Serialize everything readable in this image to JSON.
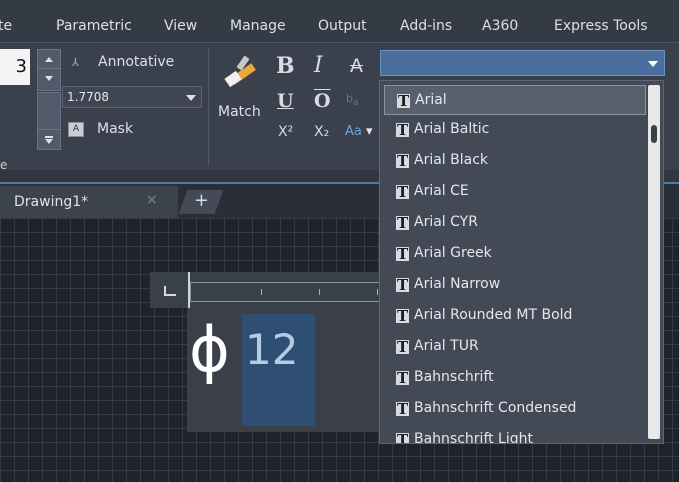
{
  "menubar": {
    "items": [
      "te",
      "Parametric",
      "View",
      "Manage",
      "Output",
      "Add-ins",
      "A360",
      "Express Tools"
    ]
  },
  "ribbon": {
    "text_height_value": "3",
    "annotative_label": "Annotative",
    "height_combo_value": "1.7708",
    "mask_label": "Mask",
    "panel_title_fragment": "e",
    "match_label": "Match",
    "bold_label": "B",
    "italic_label": "I",
    "strike_label": "A",
    "underline_label": "U",
    "overline_label": "O",
    "superscript_label": "X²",
    "subscript_label": "X₂",
    "case_label": "Aa"
  },
  "tabs": {
    "drawing_tab_label": "Drawing1*",
    "close_glyph": "×",
    "add_glyph": "+"
  },
  "editor": {
    "symbol": "ϕ",
    "selected_text": "12"
  },
  "font_dropdown": {
    "current_value": "",
    "items": [
      "Arial",
      "Arial Baltic",
      "Arial Black",
      "Arial CE",
      "Arial CYR",
      "Arial Greek",
      "Arial Narrow",
      "Arial Rounded MT Bold",
      "Arial TUR",
      "Bahnschrift",
      "Bahnschrift Condensed",
      "Bahnschrift Light"
    ],
    "selected_index": 0
  },
  "colors": {
    "accent": "#4a6f9c",
    "selection_highlight": "#2f4e73"
  }
}
